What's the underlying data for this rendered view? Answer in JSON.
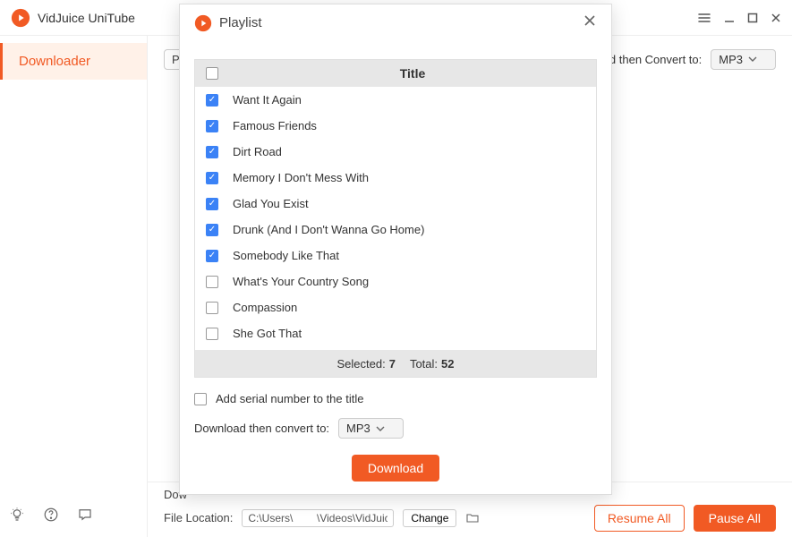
{
  "app": {
    "title": "VidJuice UniTube"
  },
  "sidebar": {
    "active_tab": "Downloader"
  },
  "toolbar": {
    "paste_label": "Pa",
    "convert_label": "Download then Convert to:",
    "convert_value": "MP3"
  },
  "bottom": {
    "dow_label": "Dow",
    "file_location_label": "File Location:",
    "file_location_value": "C:\\Users\\        \\Videos\\VidJuice\\",
    "change_label": "Change",
    "resume_label": "Resume All",
    "pause_label": "Pause All"
  },
  "modal": {
    "title": "Playlist",
    "table_header": "Title",
    "items": [
      {
        "checked": true,
        "title": "Want It Again"
      },
      {
        "checked": true,
        "title": "Famous Friends"
      },
      {
        "checked": true,
        "title": "Dirt Road"
      },
      {
        "checked": true,
        "title": "Memory I Don't Mess With"
      },
      {
        "checked": true,
        "title": "Glad You Exist"
      },
      {
        "checked": true,
        "title": "Drunk (And I Don't Wanna Go Home)"
      },
      {
        "checked": true,
        "title": "Somebody Like That"
      },
      {
        "checked": false,
        "title": "What's Your Country Song"
      },
      {
        "checked": false,
        "title": "Compassion"
      },
      {
        "checked": false,
        "title": "She Got That"
      }
    ],
    "selected_label": "Selected:",
    "selected_count": "7",
    "total_label": "Total:",
    "total_count": "52",
    "serial_label": "Add serial number to the title",
    "convert_label": "Download then convert to:",
    "convert_value": "MP3",
    "download_label": "Download"
  }
}
